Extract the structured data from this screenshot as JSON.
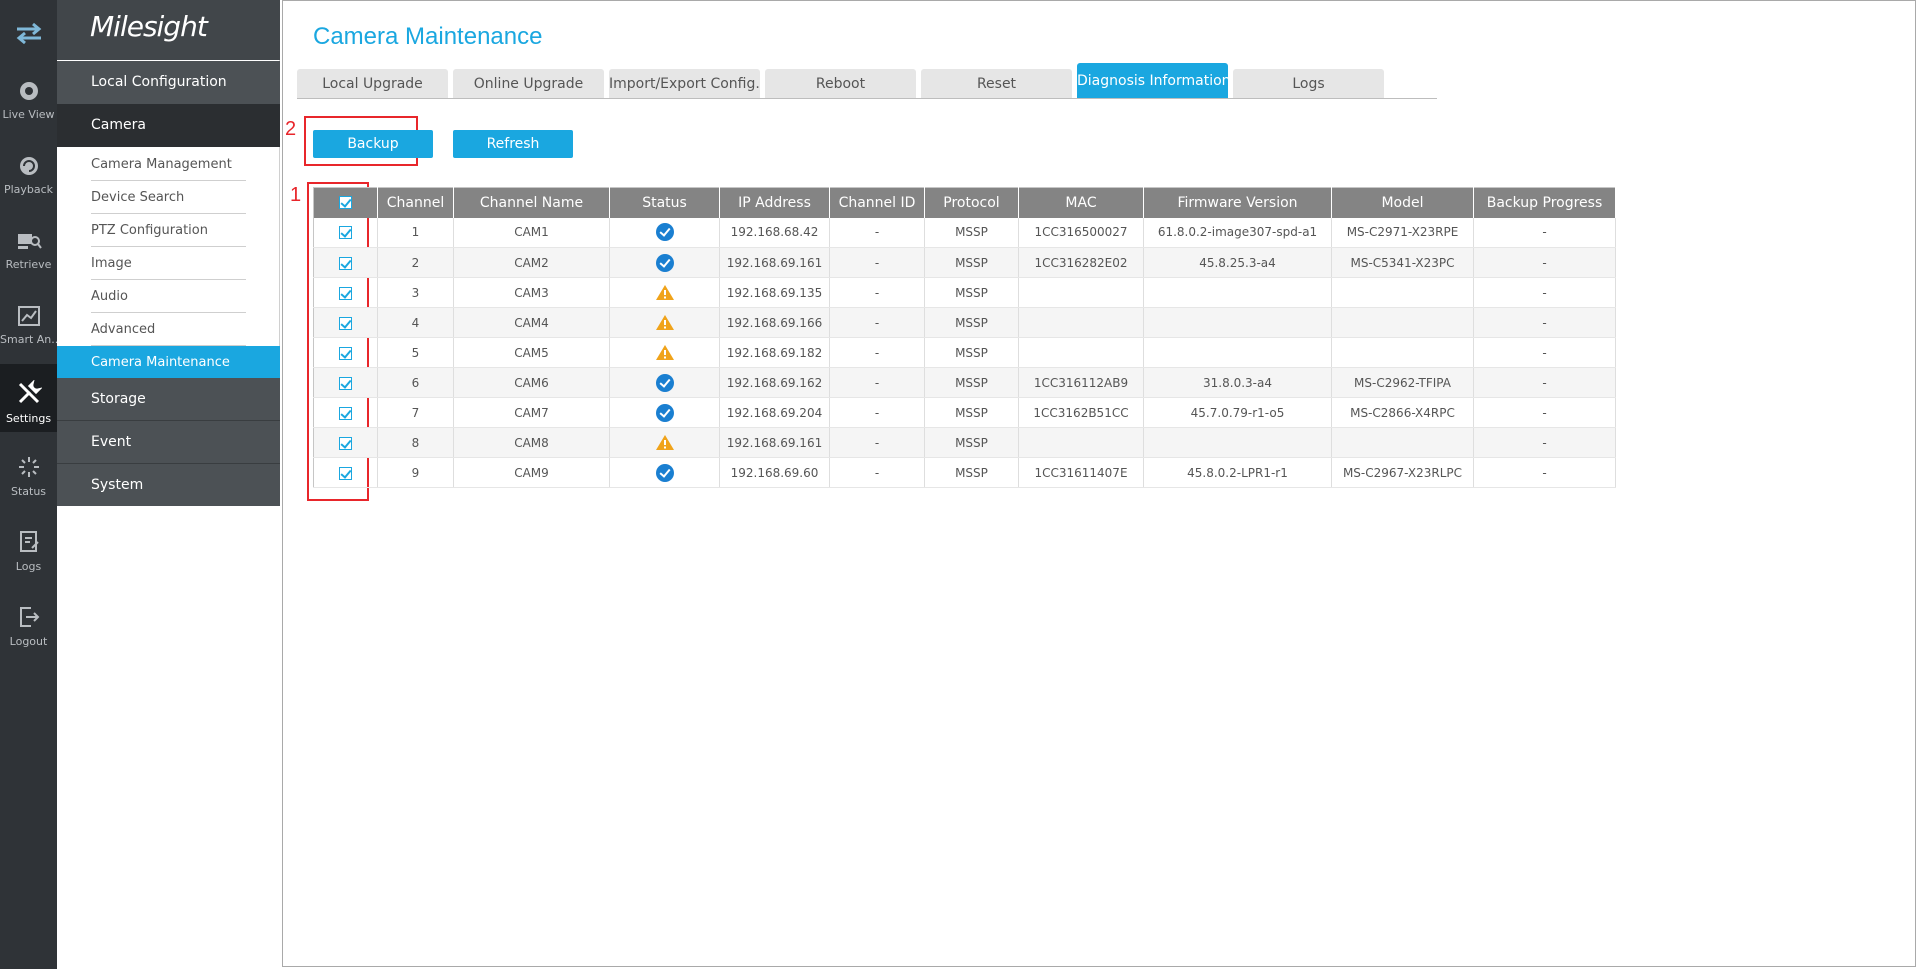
{
  "brand": "Milesight",
  "rail": [
    {
      "name": "menu-toggle",
      "icon": "swap-arrows-icon",
      "label": ""
    },
    {
      "name": "live-view",
      "icon": "live-view-icon",
      "label": "Live View"
    },
    {
      "name": "playback",
      "icon": "playback-icon",
      "label": "Playback"
    },
    {
      "name": "retrieve",
      "icon": "retrieve-icon",
      "label": "Retrieve"
    },
    {
      "name": "smart-analysis",
      "icon": "chart-icon",
      "label": "Smart An..."
    },
    {
      "name": "settings",
      "icon": "wrench-icon",
      "label": "Settings"
    },
    {
      "name": "status",
      "icon": "status-icon",
      "label": "Status"
    },
    {
      "name": "logs",
      "icon": "logs-icon",
      "label": "Logs"
    },
    {
      "name": "logout",
      "icon": "logout-icon",
      "label": "Logout"
    }
  ],
  "menu": {
    "local_configuration": "Local Configuration",
    "camera": "Camera",
    "camera_subitems": [
      "Camera Management",
      "Device Search",
      "PTZ Configuration",
      "Image",
      "Audio",
      "Advanced",
      "Camera Maintenance"
    ],
    "storage": "Storage",
    "event": "Event",
    "system": "System"
  },
  "page": {
    "title": "Camera Maintenance",
    "tabs": [
      "Local Upgrade",
      "Online Upgrade",
      "Import/Export Config...",
      "Reboot",
      "Reset",
      "Diagnosis Information",
      "Logs"
    ],
    "active_tab": "Diagnosis Information",
    "backup_label": "Backup",
    "refresh_label": "Refresh",
    "marker_1": "1",
    "marker_2": "2"
  },
  "table": {
    "columns": [
      "Channel",
      "Channel Name",
      "Status",
      "IP Address",
      "Channel ID",
      "Protocol",
      "MAC",
      "Firmware Version",
      "Model",
      "Backup Progress"
    ],
    "rows": [
      {
        "channel": "1",
        "name": "CAM1",
        "status": "ok",
        "ip": "192.168.68.42",
        "channel_id": "-",
        "protocol": "MSSP",
        "mac": "1CC316500027",
        "firmware": "61.8.0.2-image307-spd-a1",
        "model": "MS-C2971-X23RPE",
        "progress": "-"
      },
      {
        "channel": "2",
        "name": "CAM2",
        "status": "ok",
        "ip": "192.168.69.161",
        "channel_id": "-",
        "protocol": "MSSP",
        "mac": "1CC316282E02",
        "firmware": "45.8.25.3-a4",
        "model": "MS-C5341-X23PC",
        "progress": "-"
      },
      {
        "channel": "3",
        "name": "CAM3",
        "status": "warn",
        "ip": "192.168.69.135",
        "channel_id": "-",
        "protocol": "MSSP",
        "mac": "",
        "firmware": "",
        "model": "",
        "progress": "-"
      },
      {
        "channel": "4",
        "name": "CAM4",
        "status": "warn",
        "ip": "192.168.69.166",
        "channel_id": "-",
        "protocol": "MSSP",
        "mac": "",
        "firmware": "",
        "model": "",
        "progress": "-"
      },
      {
        "channel": "5",
        "name": "CAM5",
        "status": "warn",
        "ip": "192.168.69.182",
        "channel_id": "-",
        "protocol": "MSSP",
        "mac": "",
        "firmware": "",
        "model": "",
        "progress": "-"
      },
      {
        "channel": "6",
        "name": "CAM6",
        "status": "ok",
        "ip": "192.168.69.162",
        "channel_id": "-",
        "protocol": "MSSP",
        "mac": "1CC316112AB9",
        "firmware": "31.8.0.3-a4",
        "model": "MS-C2962-TFIPA",
        "progress": "-"
      },
      {
        "channel": "7",
        "name": "CAM7",
        "status": "ok",
        "ip": "192.168.69.204",
        "channel_id": "-",
        "protocol": "MSSP",
        "mac": "1CC3162B51CC",
        "firmware": "45.7.0.79-r1-o5",
        "model": "MS-C2866-X4RPC",
        "progress": "-"
      },
      {
        "channel": "8",
        "name": "CAM8",
        "status": "warn",
        "ip": "192.168.69.161",
        "channel_id": "-",
        "protocol": "MSSP",
        "mac": "",
        "firmware": "",
        "model": "",
        "progress": "-"
      },
      {
        "channel": "9",
        "name": "CAM9",
        "status": "ok",
        "ip": "192.168.69.60",
        "channel_id": "-",
        "protocol": "MSSP",
        "mac": "1CC31611407E",
        "firmware": "45.8.0.2-LPR1-r1",
        "model": "MS-C2967-X23RLPC",
        "progress": "-"
      }
    ]
  },
  "colors": {
    "accent": "#1aa7e0",
    "ok": "#1a7fd1",
    "warn": "#f0a31a",
    "highlight": "#e8262b"
  }
}
